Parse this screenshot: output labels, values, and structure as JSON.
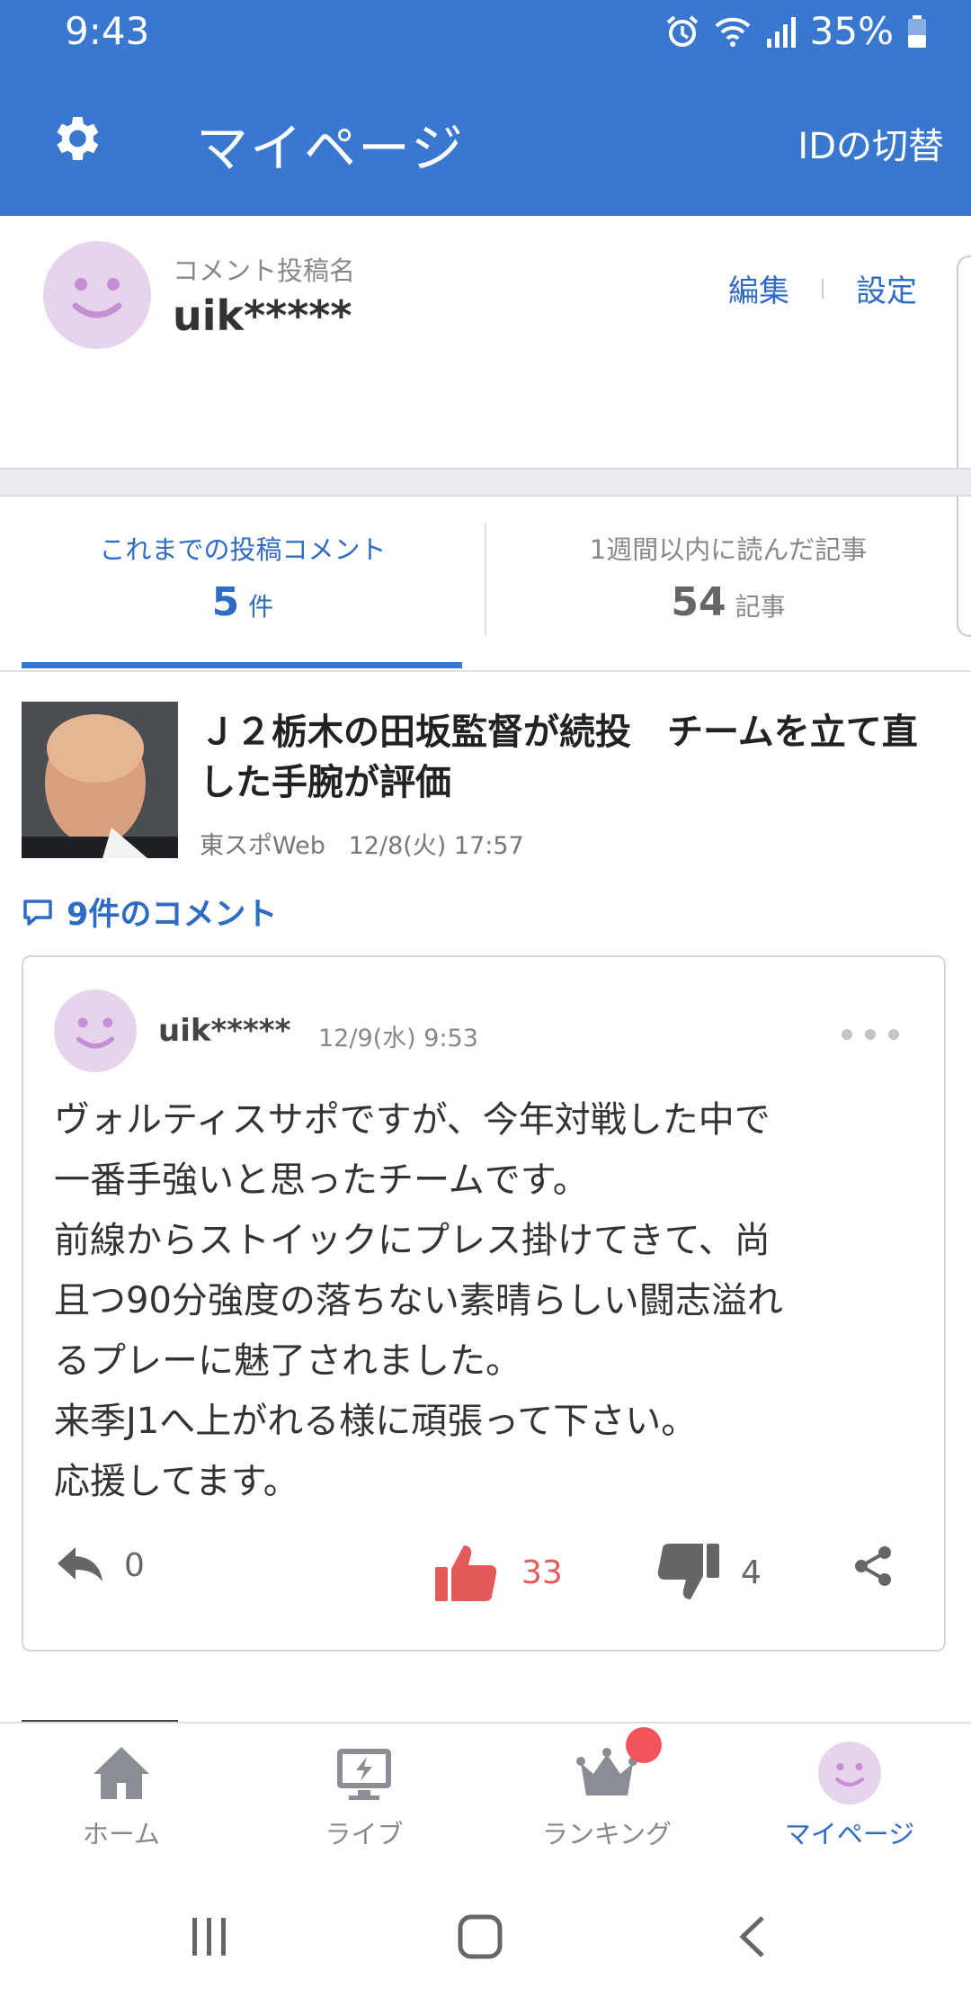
{
  "status_bar": {
    "time": "9:43",
    "battery": "35%"
  },
  "app_bar": {
    "title": "マイページ",
    "switch_id": "IDの切替"
  },
  "profile": {
    "label": "コメント投稿名",
    "username": "uik*****",
    "edit": "編集",
    "settings": "設定"
  },
  "stats": [
    {
      "label": "これまでの投稿コメント",
      "value": "5",
      "unit": "件"
    },
    {
      "label": "1週間以内に読んだ記事",
      "value": "54",
      "unit": "記事"
    }
  ],
  "article": {
    "title": "Ｊ２栃木の田坂監督が続投　チームを立て直した手腕が評価",
    "source": "東スポWeb",
    "datetime": "12/8(火) 17:57",
    "comments_link": "9件のコメント"
  },
  "comment": {
    "user": "uik*****",
    "datetime": "12/9(水) 9:53",
    "lines": [
      "ヴォルティスサポですが、今年対戦した中で",
      "一番手強いと思ったチームです。",
      "前線からストイックにプレス掛けてきて、尚",
      "且つ90分強度の落ちない素晴らしい闘志溢れ",
      "るプレーに魅了されました。",
      "来季J1へ上がれる様に頑張って下さい。",
      "応援してます。"
    ],
    "reply_count": "0",
    "like_count": "33",
    "dislike_count": "4"
  },
  "bottom_nav": [
    {
      "label": "ホーム",
      "icon": "home-icon"
    },
    {
      "label": "ライブ",
      "icon": "live-icon"
    },
    {
      "label": "ランキング",
      "icon": "crown-icon"
    },
    {
      "label": "マイページ",
      "icon": "smiley-avatar-icon"
    }
  ],
  "colors": {
    "brand": "#3a78cf",
    "link": "#2e6bc4",
    "like": "#e35a5a",
    "avatar": "#e8d3ec",
    "badge": "#f2545b"
  }
}
